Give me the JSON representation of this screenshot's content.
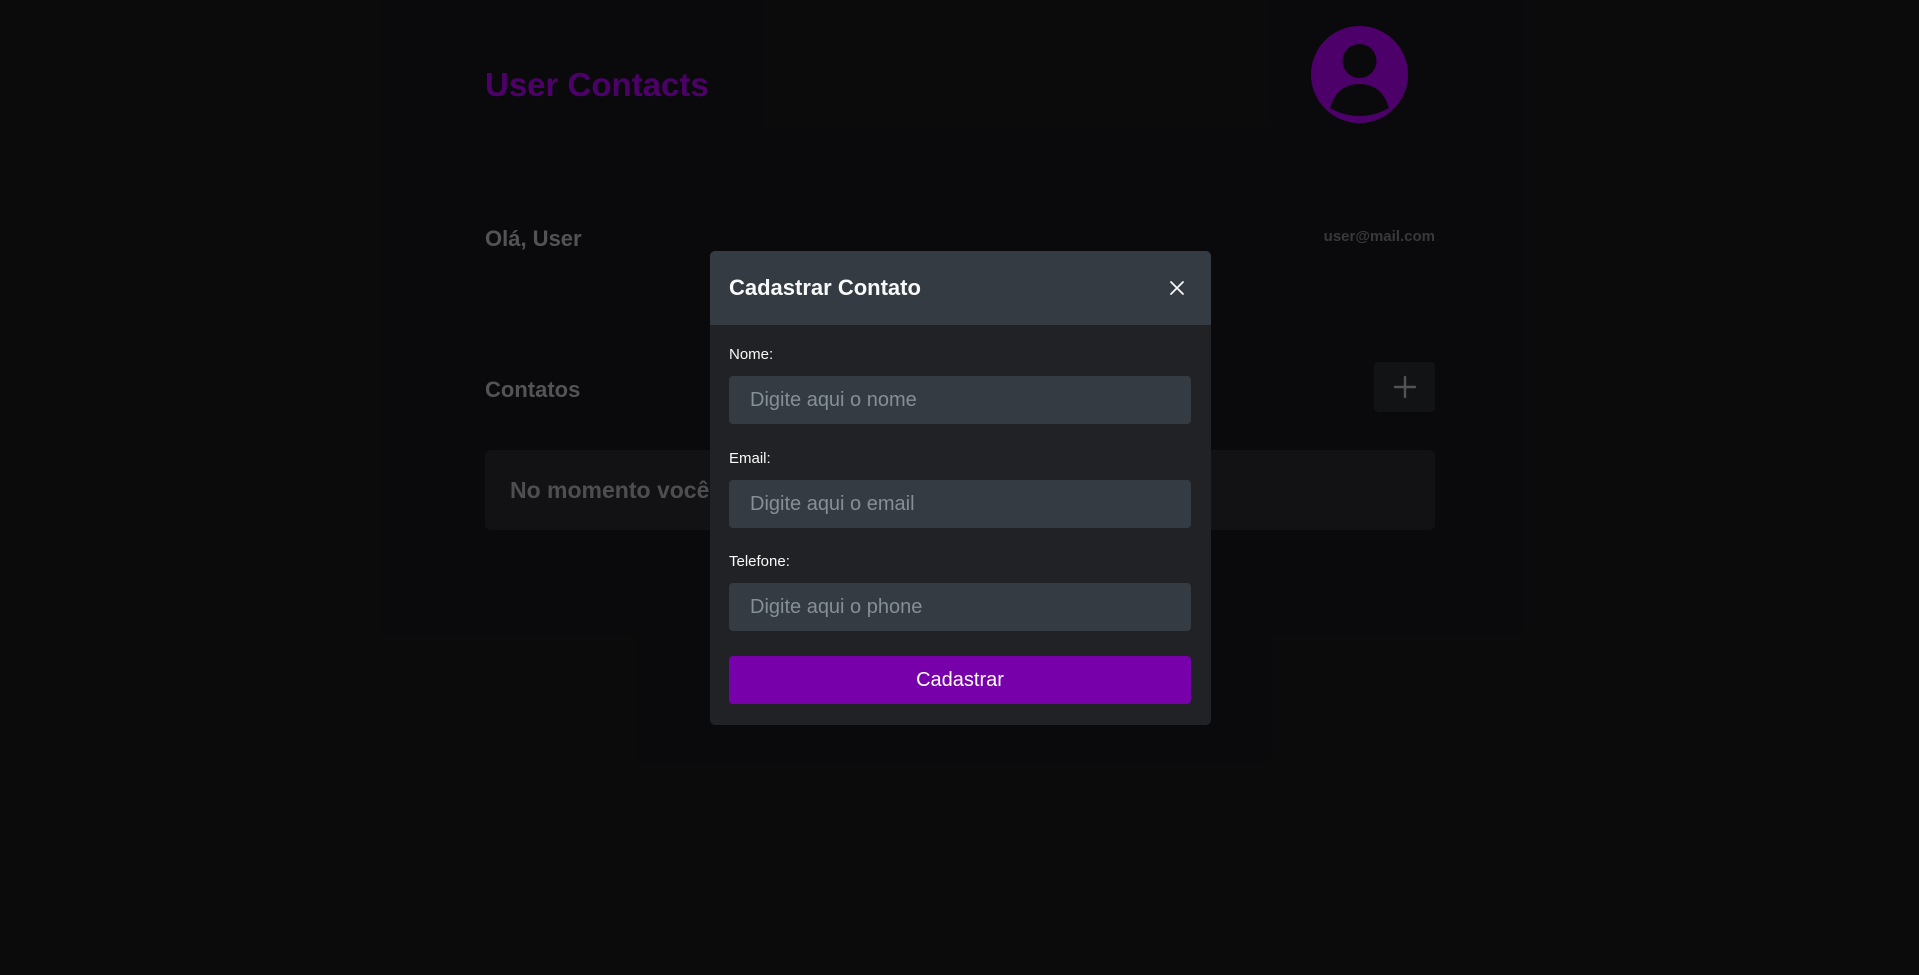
{
  "header": {
    "app_title": "User Contacts",
    "avatar_icon": "user-avatar-icon"
  },
  "greeting": {
    "text": "Olá, User",
    "email": "user@mail.com"
  },
  "contacts": {
    "title": "Contatos",
    "add_icon": "plus-icon",
    "empty_message": "No momento você"
  },
  "modal": {
    "title": "Cadastrar Contato",
    "close_icon": "close-icon",
    "fields": [
      {
        "label": "Nome:",
        "placeholder": "Digite aqui o nome",
        "value": ""
      },
      {
        "label": "Email:",
        "placeholder": "Digite aqui o email",
        "value": ""
      },
      {
        "label": "Telefone:",
        "placeholder": "Digite aqui o phone",
        "value": ""
      }
    ],
    "submit_label": "Cadastrar"
  },
  "colors": {
    "brand": "#8000b0",
    "button": "#7800aa",
    "background": "#121214",
    "modal_header": "#343b43"
  }
}
